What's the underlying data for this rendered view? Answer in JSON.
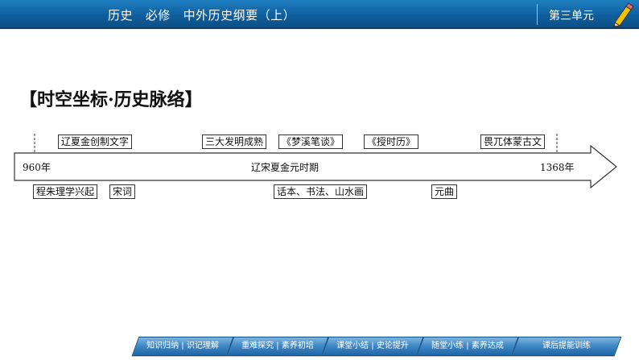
{
  "header": {
    "title": "历史   必修   中外历史纲要（上）",
    "unit": "第三单元"
  },
  "section_title": "【时空坐标·历史脉络】",
  "timeline": {
    "start_year": "960年",
    "end_year": "1368年",
    "period": "辽宋夏金元时期",
    "events_above": [
      "辽夏金创制文字",
      "三大发明成熟",
      "《梦溪笔谈》",
      "《授时历》",
      "畏兀体蒙古文"
    ],
    "events_below": [
      "程朱理学兴起",
      "宋词",
      "话本、书法、山水画",
      "元曲"
    ]
  },
  "nav": {
    "items": [
      "知识归纳 | 识记理解",
      "重难探究 | 素养初培",
      "课堂小结 | 史论提升",
      "随堂小练 | 素养达成",
      "课后提能训练"
    ]
  },
  "colors": {
    "header_bg": "#0f5f9e",
    "nav_bg": "#3c86c4"
  },
  "icons": {
    "header_decoration": "pencil-icon",
    "timeline_head": "arrow-right-icon"
  }
}
